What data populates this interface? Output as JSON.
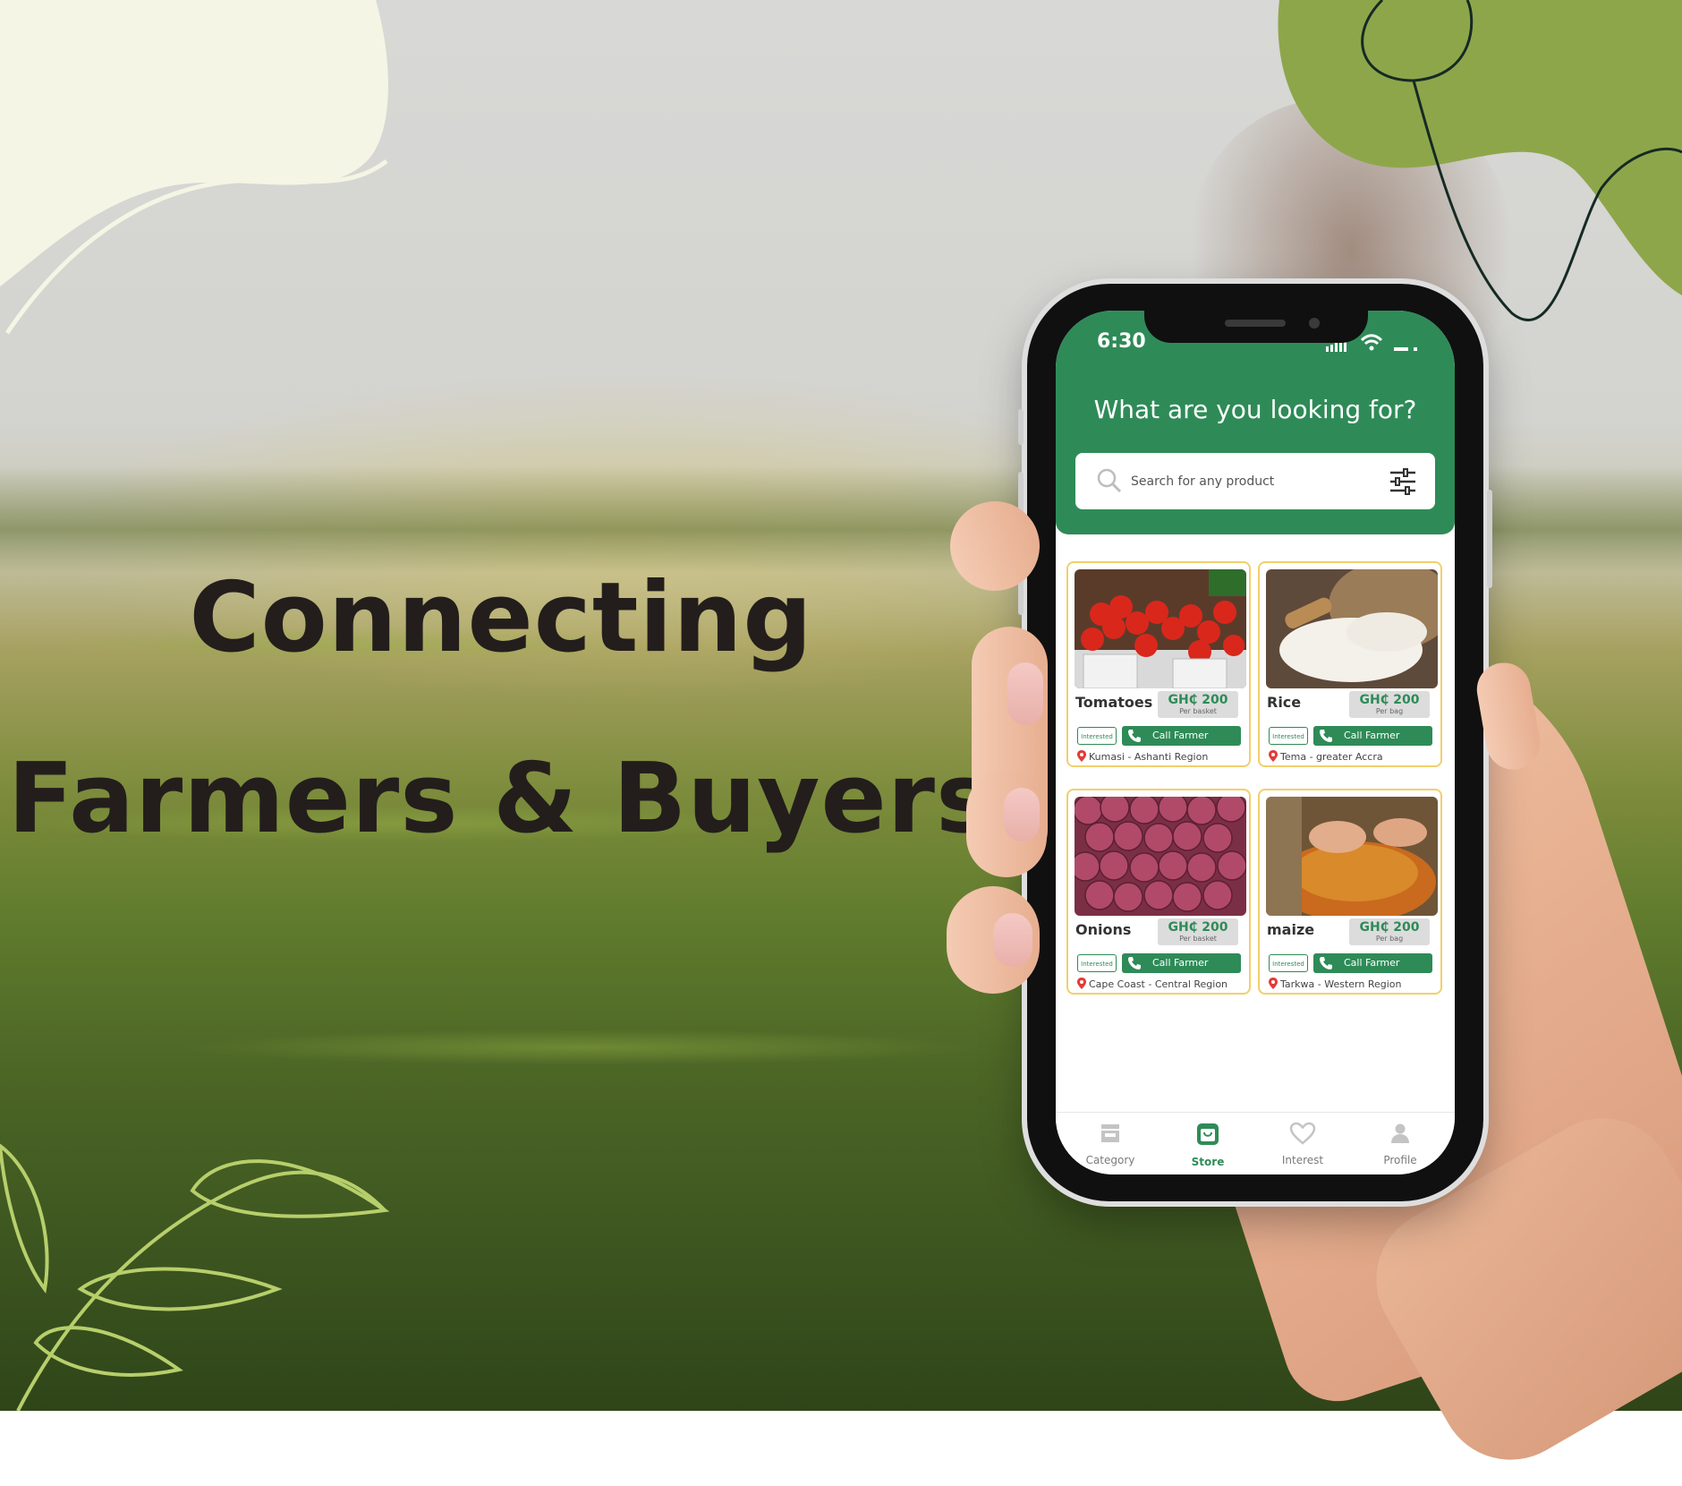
{
  "headline": {
    "line1": "Connecting",
    "line2": "Farmers & Buyers"
  },
  "phone": {
    "status_time": "6:30",
    "question": "What are you looking for?",
    "search": {
      "placeholder": "Search for any product"
    },
    "products": [
      {
        "name": "Tomatoes",
        "price": "GH₵ 200",
        "unit": "Per basket",
        "interested_label": "Interested",
        "call_label": "Call Farmer",
        "location": "Kumasi - Ashanti Region"
      },
      {
        "name": "Rice",
        "price": "GH₵ 200",
        "unit": "Per bag",
        "interested_label": "Interested",
        "call_label": "Call Farmer",
        "location": "Tema - greater Accra"
      },
      {
        "name": "Onions",
        "price": "GH₵ 200",
        "unit": "Per basket",
        "interested_label": "Interested",
        "call_label": "Call Farmer",
        "location": "Cape Coast - Central Region"
      },
      {
        "name": "maize",
        "price": "GH₵ 200",
        "unit": "Per bag",
        "interested_label": "Interested",
        "call_label": "Call Farmer",
        "location": "Tarkwa - Western Region"
      }
    ],
    "tabs": [
      {
        "label": "Category",
        "icon": "store-icon",
        "active": false
      },
      {
        "label": "Store",
        "icon": "shopping-bag-icon",
        "active": true
      },
      {
        "label": "Interest",
        "icon": "heart-icon",
        "active": false
      },
      {
        "label": "Profile",
        "icon": "person-icon",
        "active": false
      }
    ]
  },
  "colors": {
    "brand_green": "#2e8b57",
    "card_border": "#f2cf6a",
    "headline": "#231e1c"
  }
}
